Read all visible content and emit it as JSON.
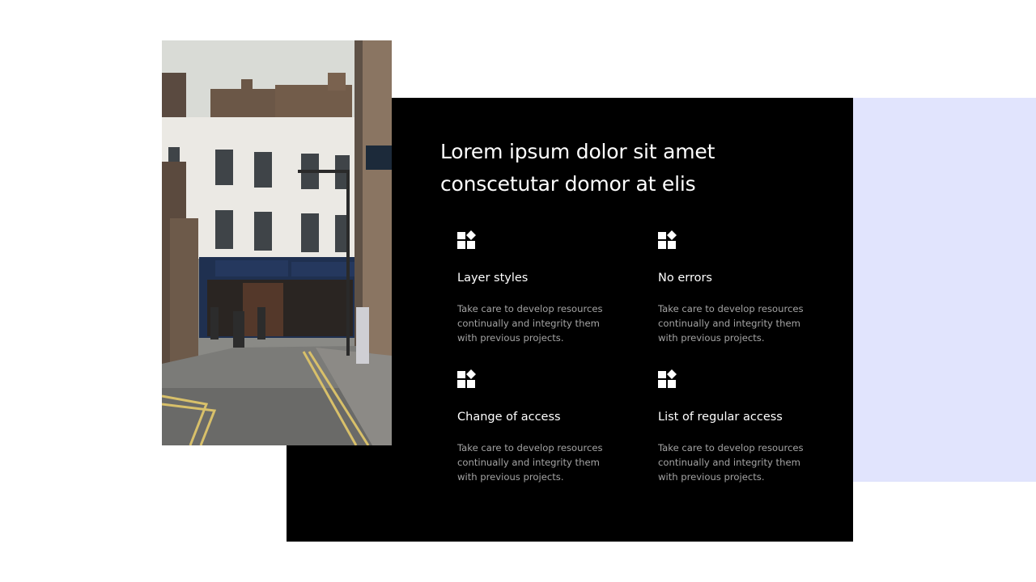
{
  "hero": {
    "title": "Lorem ipsum dolor sit amet conscetutar domor at elis",
    "photo_alt": "City street with white buildings"
  },
  "features": [
    {
      "icon": "widgets-icon",
      "title": "Layer styles",
      "description": "Take care to develop resources continually and integrity them with previous projects."
    },
    {
      "icon": "widgets-icon",
      "title": "No errors",
      "description": "Take care to develop resources continually and integrity them with previous projects."
    },
    {
      "icon": "widgets-icon",
      "title": "Change of access",
      "description": "Take care to develop resources continually and integrity them with previous projects."
    },
    {
      "icon": "widgets-icon",
      "title": "List of regular access",
      "description": "Take care to develop resources continually and integrity them with previous projects."
    }
  ],
  "colors": {
    "panel_background": "#000000",
    "accent_panel": "#e1e4fd",
    "text_primary": "#ffffff",
    "text_secondary": "#a3a3a3"
  }
}
